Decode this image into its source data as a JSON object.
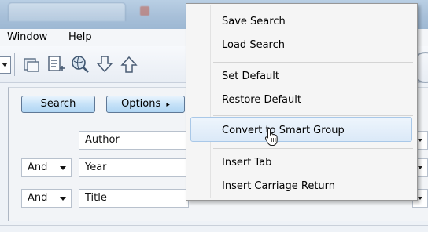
{
  "menubar": {
    "window": "Window",
    "help": "Help"
  },
  "toolbar": {
    "icons": [
      "group-icon",
      "new-list-icon",
      "globe-search-icon",
      "import-icon",
      "export-icon"
    ]
  },
  "search_panel": {
    "search_button": "Search",
    "options_button": "Options",
    "options_arrow": "▸",
    "rows": [
      {
        "operator": "",
        "field": "Author"
      },
      {
        "operator": "And",
        "field": "Year"
      },
      {
        "operator": "And",
        "field": "Title"
      }
    ]
  },
  "context_menu": {
    "items": [
      "Save Search",
      "Load Search",
      "Set Default",
      "Restore Default",
      "Convert to Smart Group",
      "Insert Tab",
      "Insert Carriage Return"
    ],
    "highlighted": "Convert to Smart Group"
  },
  "colors": {
    "titlebar": "#a8c0d9",
    "button_gradient": "#c6e2f8",
    "menu_highlight": "#dbe9f8"
  }
}
